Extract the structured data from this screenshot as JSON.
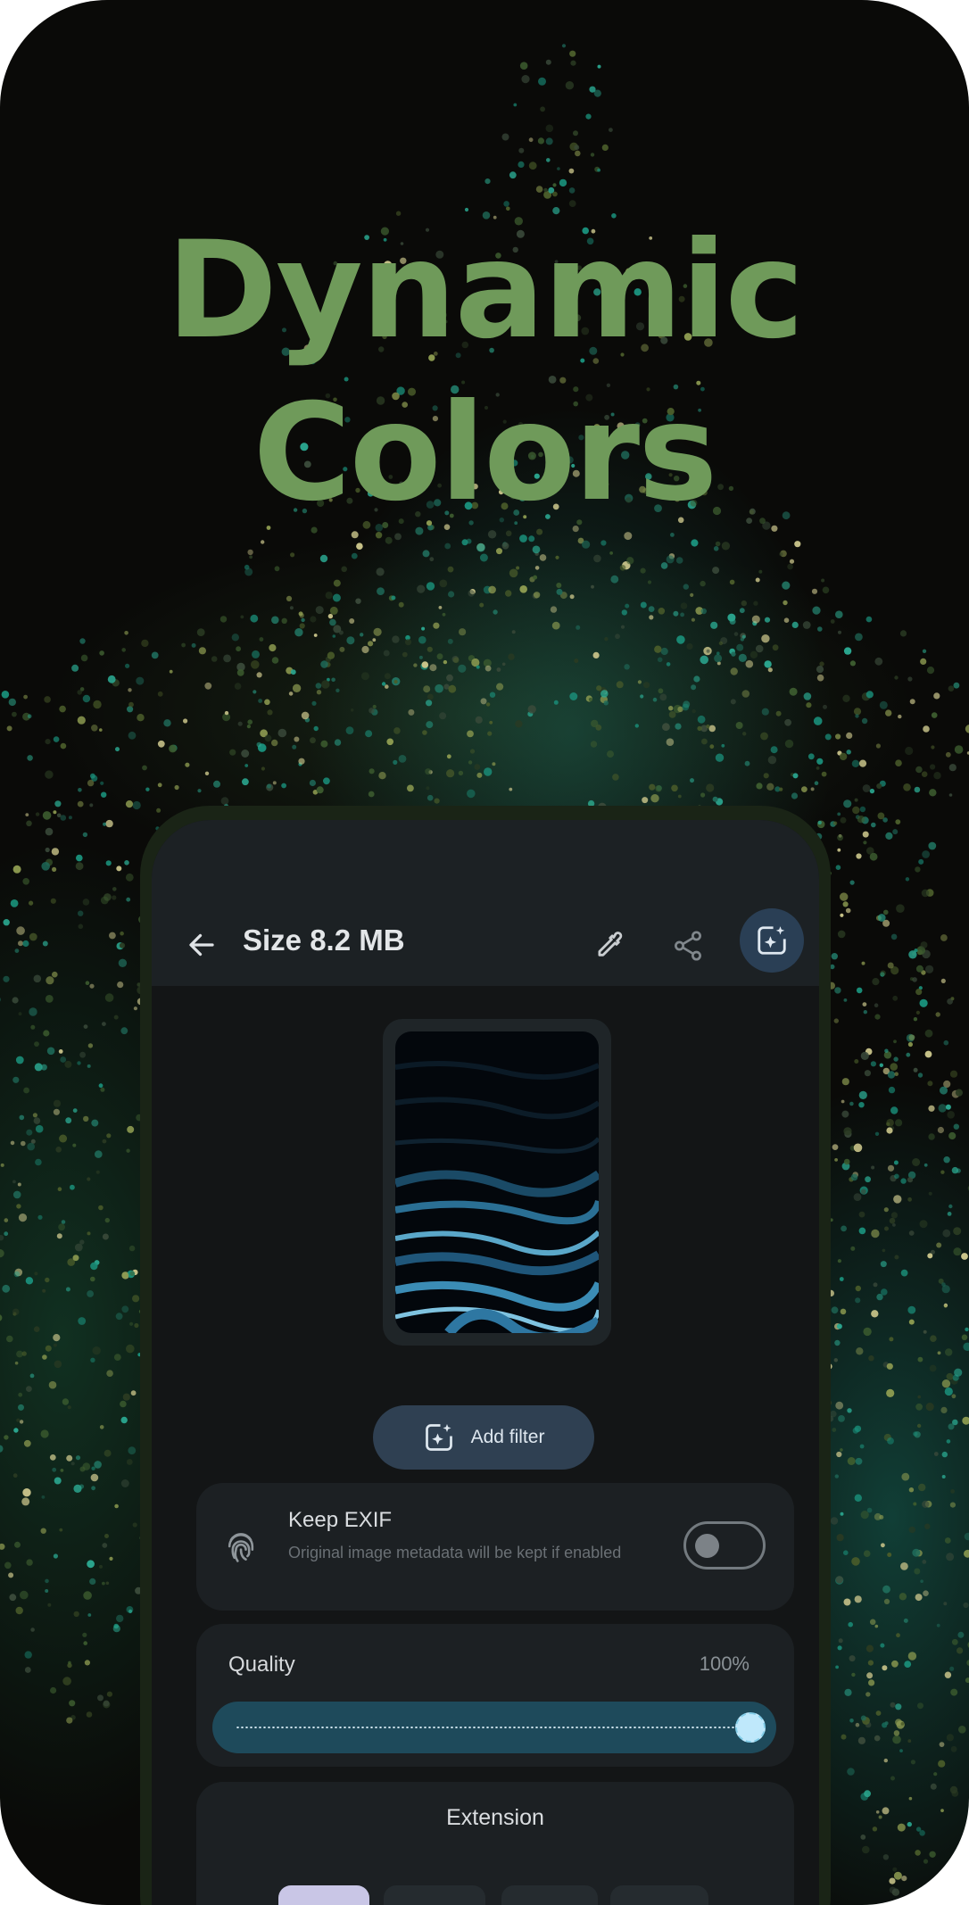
{
  "promo": {
    "headline_line1": "Dynamic",
    "headline_line2": "Colors"
  },
  "app_bar": {
    "back_icon": "arrow-left-icon",
    "title": "Size 8.2 MB",
    "actions": [
      "color-picker-icon",
      "share-icon",
      "add-filter-icon"
    ]
  },
  "preview": {
    "image": "blue wave wallpaper preview"
  },
  "add_filter": {
    "label": "Add filter",
    "icon": "add-filter-icon"
  },
  "exif": {
    "icon": "fingerprint-icon",
    "title": "Keep EXIF",
    "subtitle": "Original image metadata will be kept if enabled",
    "enabled": false
  },
  "quality": {
    "label": "Quality",
    "value": "100%",
    "level": 1.0
  },
  "extension": {
    "title": "Extension",
    "options_visible": 4,
    "selected_index": 0
  },
  "colors": {
    "headline": "#6f9a5a",
    "app_surface": "#131516",
    "top_bar": "#1c2124",
    "accent_container": "#2f4052",
    "slider_track": "#1e4a5b",
    "slider_thumb": "#bfe8fb",
    "selected_chip": "#c9c6e6"
  }
}
